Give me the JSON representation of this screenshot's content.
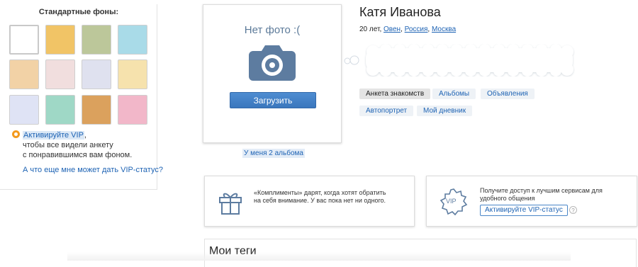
{
  "backgrounds": {
    "title": "Стандартные фоны:",
    "swatches": [
      {
        "name": "white",
        "color": "#ffffff"
      },
      {
        "name": "autumn-trees",
        "color": "#f1c466"
      },
      {
        "name": "sneakers",
        "color": "#bcc79a"
      },
      {
        "name": "blue-pattern",
        "color": "#a9dbe8"
      },
      {
        "name": "colorful-doodle",
        "color": "#f2d2a6"
      },
      {
        "name": "pink-grid",
        "color": "#f1dede"
      },
      {
        "name": "lavender-flowers",
        "color": "#dfe1ef"
      },
      {
        "name": "yellow-flowers",
        "color": "#f6e2ad"
      },
      {
        "name": "blue-floral",
        "color": "#dfe3f5"
      },
      {
        "name": "mint-floral",
        "color": "#9fd8c6"
      },
      {
        "name": "wood",
        "color": "#dba15d"
      },
      {
        "name": "pink-roses",
        "color": "#f2b7c9"
      }
    ],
    "vip_link": "Активируйте VIP",
    "vip_line2": "чтобы все видели анкету",
    "vip_line3": "с понравившимся вам фоном.",
    "vip_what": "А что еще мне может дать VIP-статус?"
  },
  "photo": {
    "no_photo": "Нет фото :(",
    "upload_label": "Загрузить",
    "albums_link": "У меня 2 альбома"
  },
  "profile": {
    "name": "Катя Иванова",
    "age": "20 лет,",
    "sign": "Овен",
    "country": "Россия",
    "city": "Москва"
  },
  "tabs": [
    {
      "label": "Анкета знакомств",
      "active": true
    },
    {
      "label": "Альбомы",
      "active": false
    },
    {
      "label": "Объявления",
      "active": false
    },
    {
      "label": "Автопортрет",
      "active": false
    },
    {
      "label": "Мой дневник",
      "active": false
    }
  ],
  "compliments": {
    "text": "«Комплименты» дарят, когда хотят обратить на себя внимание. У вас пока нет ни одного."
  },
  "vip_card": {
    "text": "Получите доступ к лучшим сервисам для удобного общения",
    "button": "Активируйте VIP-статус",
    "badge": "VIP",
    "help": "?"
  },
  "tags": {
    "title": "Мои теги"
  },
  "colors": {
    "accent": "#1e63b4",
    "button": "#3a76bd",
    "camera": "#5d7ca0"
  }
}
